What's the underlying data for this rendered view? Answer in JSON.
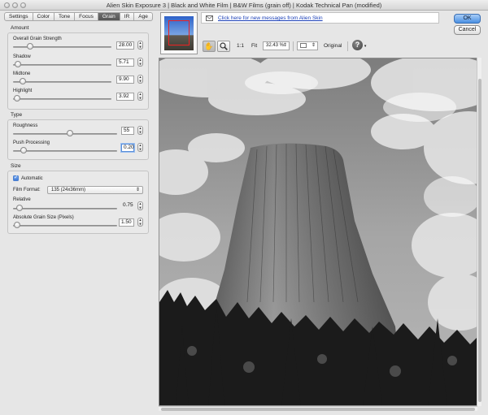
{
  "window": {
    "title": "Alien Skin Exposure 3 | Black and White Film | B&W Films (grain off) | Kodak Technical Pan (modified)"
  },
  "tabs": [
    {
      "label": "Settings",
      "active": false
    },
    {
      "label": "Color",
      "active": false
    },
    {
      "label": "Tone",
      "active": false
    },
    {
      "label": "Focus",
      "active": false
    },
    {
      "label": "Grain",
      "active": true
    },
    {
      "label": "IR",
      "active": false
    },
    {
      "label": "Age",
      "active": false
    }
  ],
  "amount": {
    "title": "Amount",
    "params": [
      {
        "label": "Overall Grain Strength",
        "value": "28.00",
        "level": 0.17
      },
      {
        "label": "Shadow",
        "value": "5.71",
        "level": 0.05
      },
      {
        "label": "Midtone",
        "value": "9.90",
        "level": 0.1
      },
      {
        "label": "Highlight",
        "value": "3.92",
        "level": 0.04
      }
    ]
  },
  "type": {
    "title": "Type",
    "params": [
      {
        "label": "Roughness",
        "value": "55",
        "level": 0.55
      },
      {
        "label": "Push Processing",
        "value": "0.20",
        "level": 0.1
      }
    ]
  },
  "size": {
    "title": "Size",
    "automatic_label": "Automatic",
    "automatic_checked": true,
    "film_format_label": "Film Format:",
    "film_format_value": "135 (24x36mm)",
    "relative_label": "Relative",
    "relative_value": "0.75",
    "relative_level": 0.06,
    "absolute_label": "Absolute Grain Size (Pixels)",
    "absolute_value": "1.50",
    "absolute_level": 0.04
  },
  "message_link": "Click here for new messages from Alien Skin",
  "buttons": {
    "ok": "OK",
    "cancel": "Cancel"
  },
  "toolbar": {
    "one_to_one": "1:1",
    "fit": "Fit",
    "zoom_value": "32.43 %",
    "original": "Original"
  },
  "icons": {
    "hand": "hand-icon",
    "zoom": "magnifier-icon",
    "help": "help-icon",
    "envelope": "envelope-icon"
  },
  "colors": {
    "accent": "#4a90e2",
    "link": "#1a3fb8",
    "active_tab": "#5e5e5e"
  }
}
